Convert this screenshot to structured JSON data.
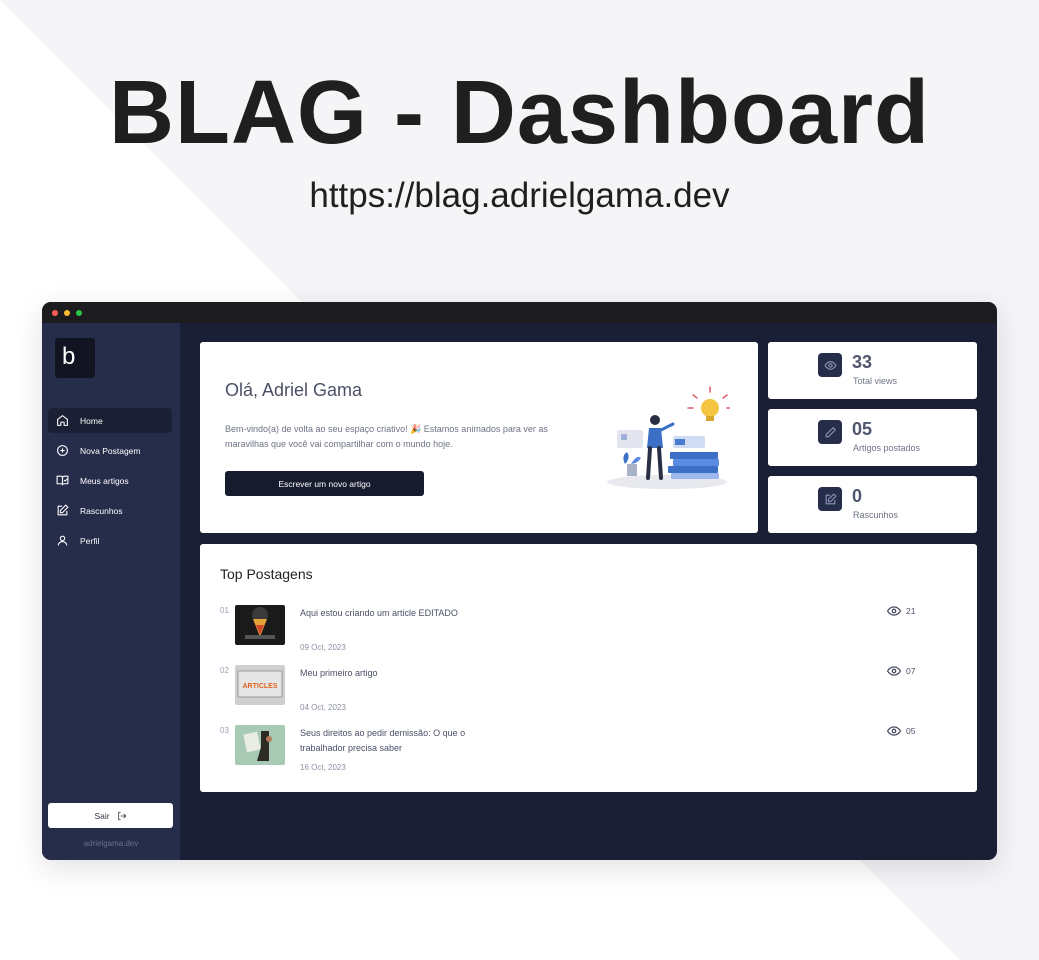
{
  "hero": {
    "title": "BLAG - Dashboard",
    "url": "https://blag.adrielgama.dev"
  },
  "sidebar": {
    "logo": "b",
    "items": [
      {
        "label": "Home",
        "icon": "home-icon",
        "active": true
      },
      {
        "label": "Nova Postagem",
        "icon": "plus-circle-icon"
      },
      {
        "label": "Meus artigos",
        "icon": "book-check-icon"
      },
      {
        "label": "Rascunhos",
        "icon": "edit-icon"
      },
      {
        "label": "Perfil",
        "icon": "user-icon"
      }
    ],
    "logout_label": "Sair",
    "footer": "adrielgama.dev"
  },
  "welcome": {
    "greeting": "Olá, Adriel Gama",
    "message": "Bem-vindo(a) de volta ao seu espaço criativo! 🎉 Estamos animados para ver as maravilhas que você vai compartilhar com o mundo hoje.",
    "cta_label": "Escrever um novo artigo"
  },
  "stats": [
    {
      "value": "33",
      "label": "Total views",
      "icon": "eye-icon"
    },
    {
      "value": "05",
      "label": "Artigos postados",
      "icon": "pencil-icon"
    },
    {
      "value": "0",
      "label": "Rascunhos",
      "icon": "edit-icon"
    }
  ],
  "top_posts": {
    "title": "Top Postagens",
    "items": [
      {
        "rank": "01",
        "title": "Aqui estou criando um article EDITADO",
        "date": "09 Oct, 2023",
        "views": "21"
      },
      {
        "rank": "02",
        "title": "Meu primeiro artigo",
        "date": "04 Oct, 2023",
        "views": "07",
        "thumb_text": "ARTICLES"
      },
      {
        "rank": "03",
        "title": "Seus direitos ao pedir demissão: O que o trabalhador precisa saber",
        "date": "16 Oct, 2023",
        "views": "05"
      }
    ]
  },
  "colors": {
    "window_bg": "#1b1f36",
    "sidebar_bg": "#262d4b",
    "accent_dark": "#171b2e"
  }
}
